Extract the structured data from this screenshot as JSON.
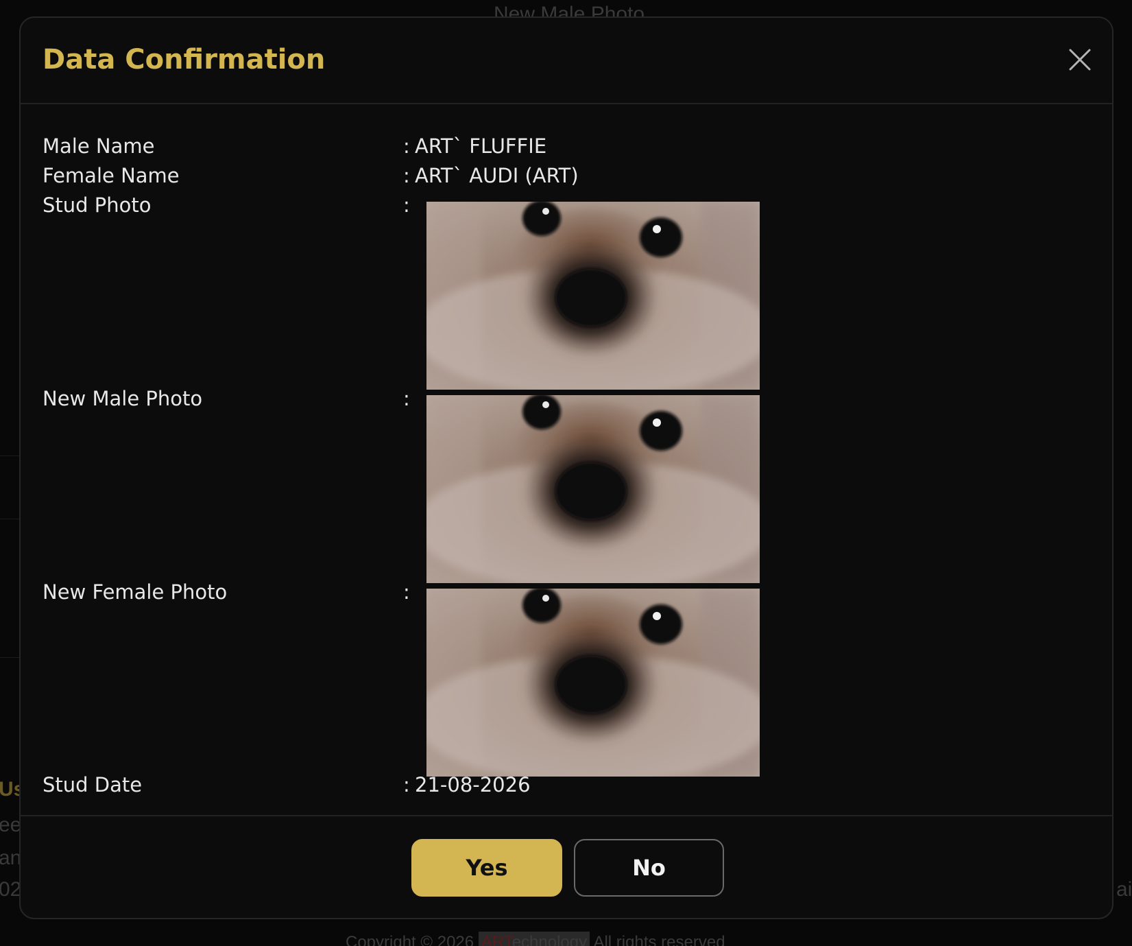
{
  "modal": {
    "title": "Data Confirmation",
    "close_icon": "close-icon"
  },
  "fields": {
    "male_name": {
      "label": "Male Name",
      "colon": ":",
      "value": "ART` FLUFFIE"
    },
    "female_name": {
      "label": "Female Name",
      "colon": ":",
      "value": "ART` AUDI (ART)"
    },
    "stud_photo": {
      "label": "Stud Photo",
      "colon": ":",
      "image": "dog-face-photo"
    },
    "new_male_photo": {
      "label": "New Male Photo",
      "colon": ":",
      "image": "dog-face-photo"
    },
    "new_female_photo": {
      "label": "New Female Photo",
      "colon": ":",
      "image": "dog-face-photo"
    },
    "stud_date": {
      "label": "Stud Date",
      "colon": ":",
      "value": "21-08-2026"
    }
  },
  "actions": {
    "yes_label": "Yes",
    "no_label": "No"
  },
  "background": {
    "top_text": "New Male Photo",
    "left_fragments": [
      "Us",
      "ee",
      "an",
      "02"
    ],
    "right_fragment": "ai",
    "footer": {
      "prefix": "Copyright © 2026 ",
      "brand_red": "ART",
      "brand_rest": "echnology",
      "suffix": " All rights reserved"
    }
  },
  "colors": {
    "accent": "#d3b552",
    "modal_bg": "#0c0c0c",
    "text": "#e8e8e8"
  }
}
